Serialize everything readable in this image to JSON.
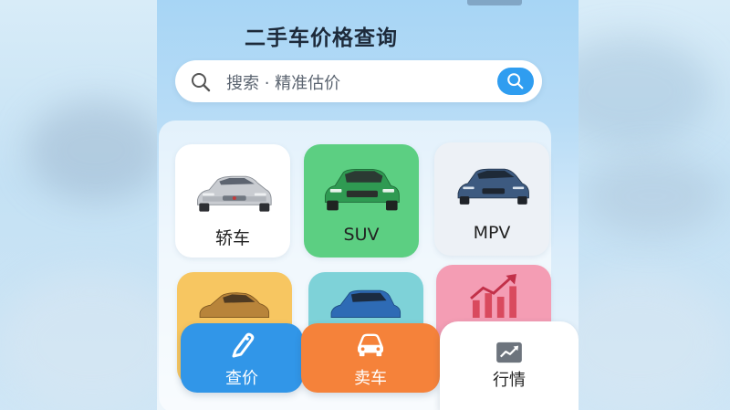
{
  "page": {
    "title": "二手车价格查询"
  },
  "search": {
    "placeholder": "搜索 · 精准估价",
    "icon": "search-icon",
    "button_icon": "search-icon"
  },
  "categories": [
    {
      "label": "轿车",
      "icon": "sedan-car-icon",
      "color": "#ffffff"
    },
    {
      "label": "SUV",
      "icon": "suv-car-icon",
      "color": "#5ccf82"
    },
    {
      "label": "MPV",
      "icon": "mpv-car-icon",
      "color": "#edf1f6"
    },
    {
      "label": "",
      "icon": "coupe-car-icon",
      "color": "#f7c661"
    },
    {
      "label": "",
      "icon": "hatchback-car-icon",
      "color": "#7ed2d8"
    },
    {
      "label": "",
      "icon": "trend-chart-icon",
      "color": "#f49db4"
    }
  ],
  "bottom_nav": [
    {
      "label": "查价",
      "icon": "price-tag-icon",
      "color": "#3196e8"
    },
    {
      "label": "卖车",
      "icon": "car-front-icon",
      "color": "#f5823a"
    },
    {
      "label": "行情",
      "icon": "market-trend-icon",
      "color": "#ffffff"
    }
  ]
}
